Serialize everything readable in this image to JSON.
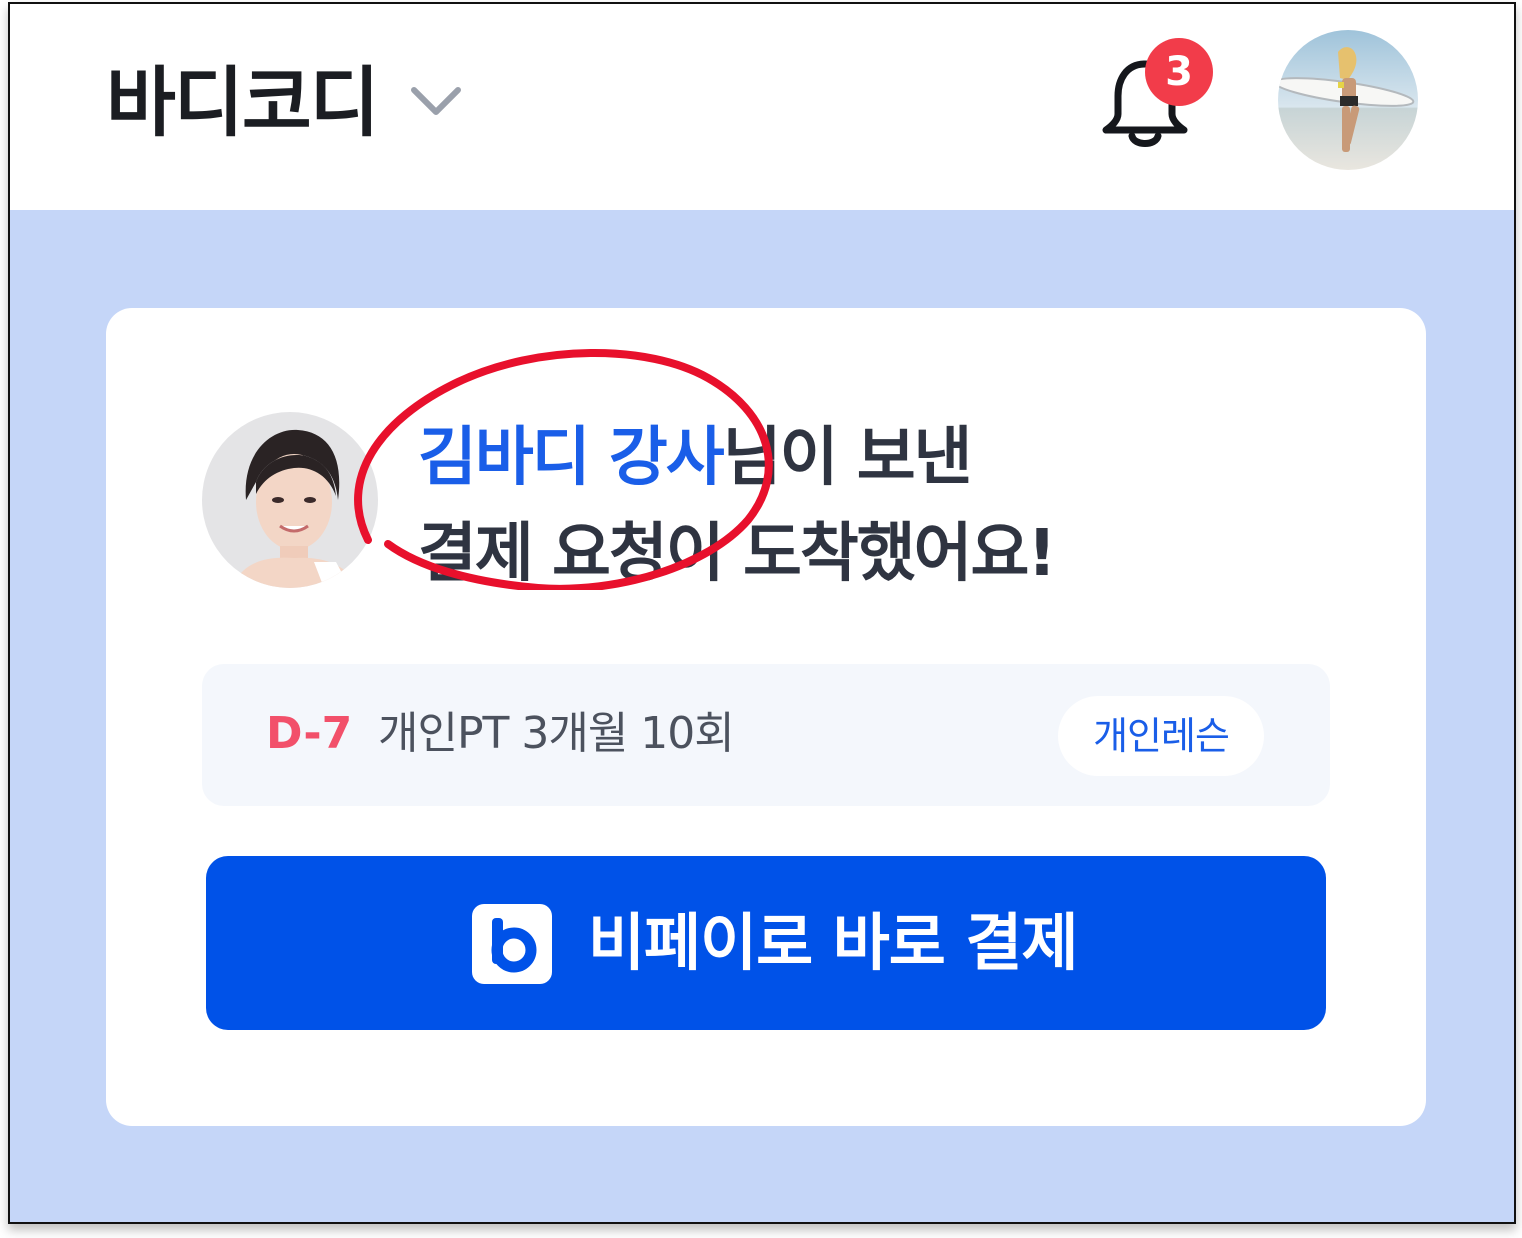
{
  "header": {
    "brand": "바디코디",
    "notification_count": "3"
  },
  "card": {
    "headline": {
      "coach_name": "김바디 강사",
      "line1_rest": "님이 보낸",
      "line2": "결제 요청이 도착했어요!"
    },
    "plan": {
      "dday": "D-7",
      "name": "개인PT 3개월 10회",
      "tag": "개인레슨"
    },
    "pay_button": {
      "label": "비페이로 바로 결제"
    }
  },
  "colors": {
    "accent": "#0052e8",
    "highlight": "#1a5ee8",
    "dday": "#f2506a",
    "badge": "#f23c4a",
    "background": "#c5d6f8",
    "annotation": "#e8102c"
  },
  "icons": {
    "brand_dropdown": "chevron-down-icon",
    "notifications": "bell-icon",
    "pay_logo": "bpay-logo-icon"
  }
}
